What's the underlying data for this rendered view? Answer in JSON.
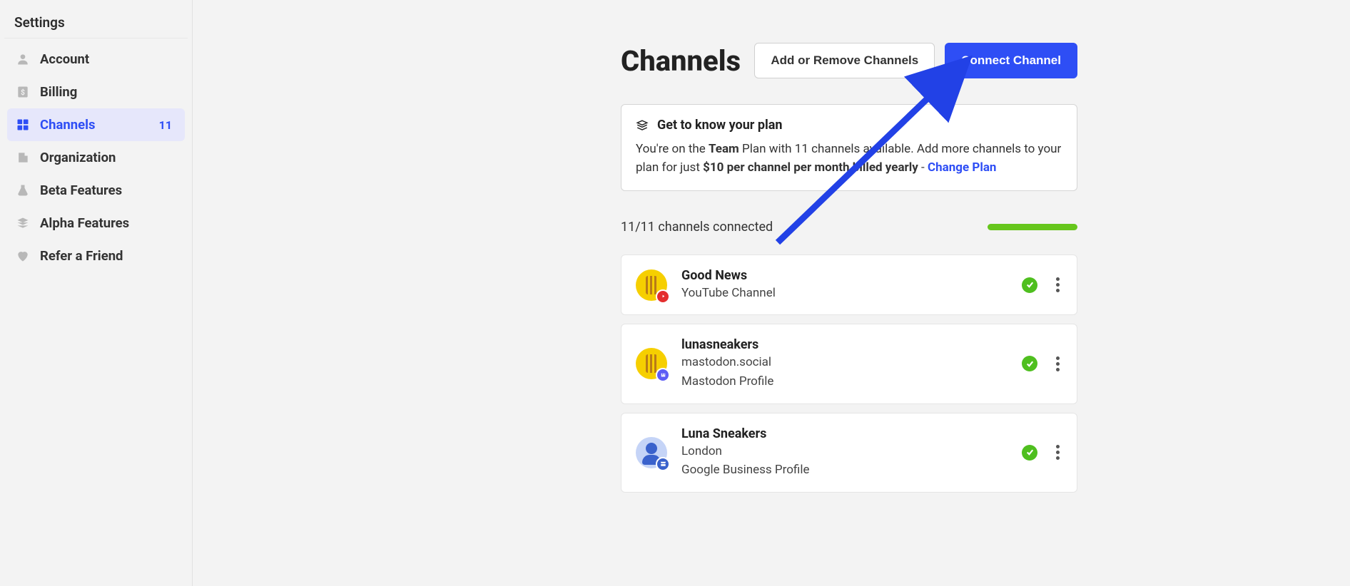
{
  "sidebar": {
    "title": "Settings",
    "items": [
      {
        "label": "Account"
      },
      {
        "label": "Billing"
      },
      {
        "label": "Channels",
        "badge": "11"
      },
      {
        "label": "Organization"
      },
      {
        "label": "Beta Features"
      },
      {
        "label": "Alpha Features"
      },
      {
        "label": "Refer a Friend"
      }
    ]
  },
  "header": {
    "title": "Channels",
    "add_remove_label": "Add or Remove Channels",
    "connect_label": "Connect Channel"
  },
  "plan_card": {
    "title": "Get to know your plan",
    "text_1": "You're on the ",
    "plan_name": "Team",
    "text_2": " Plan with 11 channels available. Add more channels to your plan for just ",
    "price_text": "$10 per channel per month billed yearly",
    "text_3": " - ",
    "change_plan_label": "Change Plan"
  },
  "status": {
    "text": "11/11 channels connected"
  },
  "channels": [
    {
      "name": "Good News",
      "meta1": "YouTube Channel",
      "meta2": ""
    },
    {
      "name": "lunasneakers",
      "meta1": "mastodon.social",
      "meta2": "Mastodon Profile"
    },
    {
      "name": "Luna Sneakers",
      "meta1": "London",
      "meta2": "Google Business Profile"
    }
  ]
}
